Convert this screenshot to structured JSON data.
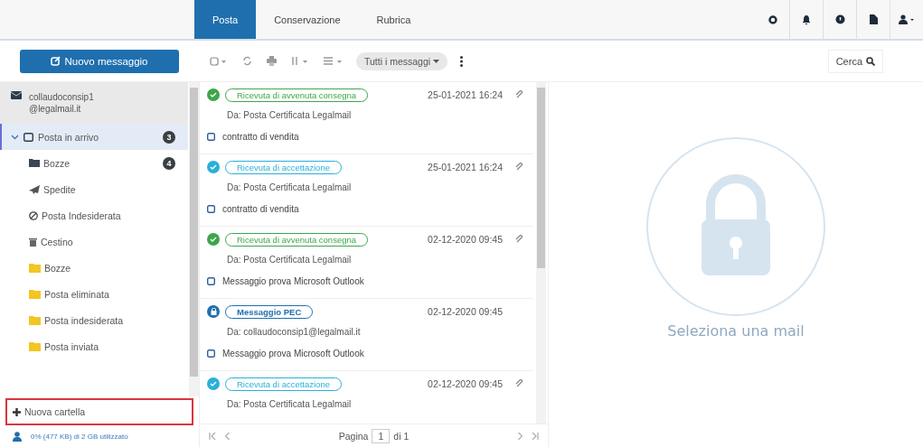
{
  "tabs": [
    {
      "label": "Posta",
      "selected": true
    },
    {
      "label": "Conservazione",
      "selected": false
    },
    {
      "label": "Rubrica",
      "selected": false
    }
  ],
  "header_icons": [
    {
      "kind": "gear"
    },
    {
      "kind": "bell"
    },
    {
      "kind": "help"
    },
    {
      "kind": "file"
    },
    {
      "kind": "user"
    }
  ],
  "new_message_button": "Nuovo messaggio",
  "toolbar": {
    "filter": "Tutti i messaggi",
    "search_button": "Cerca"
  },
  "account": {
    "name": "collaudoconsip1\n@legalmail.it"
  },
  "folders": [
    {
      "label": "Posta in arrivo",
      "kind": "inbox",
      "selected": true,
      "badge": "3",
      "expanded": true,
      "children": [
        {
          "label": "Bozze",
          "kind": "drafts",
          "selected": false,
          "badge": "4"
        },
        {
          "label": "Spedite",
          "kind": "sent",
          "selected": false
        },
        {
          "label": "Posta Indesiderata",
          "kind": "spam",
          "selected": false
        },
        {
          "label": "Cestino",
          "kind": "trash",
          "selected": false
        },
        {
          "label": "Bozze",
          "kind": "folder",
          "selected": false
        },
        {
          "label": "Posta eliminata",
          "kind": "folder",
          "selected": false
        },
        {
          "label": "Posta indesiderata",
          "kind": "folder",
          "selected": false
        },
        {
          "label": "Posta inviata",
          "kind": "folder",
          "selected": false
        }
      ]
    }
  ],
  "new_folder_button": "Nuova cartella",
  "storage": "0% (477 KB) di 2 GB utilizzato",
  "messages": [
    {
      "kind": "delivered",
      "tag": "Ricevuta di avvenuta consegna",
      "color": "#3ea64a",
      "date": "25-01-2021 16:24",
      "attachment": true,
      "from": "Da: Posta Certificata Legalmail",
      "subject": "contratto di vendita"
    },
    {
      "kind": "accepted",
      "tag": "Ricevuta di accettazione",
      "color": "#2ab0d8",
      "date": "25-01-2021 16:24",
      "attachment": true,
      "from": "Da: Posta Certificata Legalmail",
      "subject": "contratto di vendita"
    },
    {
      "kind": "delivered",
      "tag": "Ricevuta di avvenuta consegna",
      "color": "#3ea64a",
      "date": "02-12-2020 09:45",
      "attachment": true,
      "from": "Da: Posta Certificata Legalmail",
      "subject": "Messaggio prova Microsoft Outlook"
    },
    {
      "kind": "pec",
      "tag": "Messaggio PEC",
      "color": "#1f6fae",
      "date": "02-12-2020 09:45",
      "attachment": false,
      "from": "Da: collaudoconsip1@legalmail.it",
      "subject": "Messaggio prova Microsoft Outlook"
    },
    {
      "kind": "accepted",
      "tag": "Ricevuta di accettazione",
      "color": "#2ab0d8",
      "date": "02-12-2020 09:45",
      "attachment": true,
      "from": "Da: Posta Certificata Legalmail"
    }
  ],
  "pager": {
    "label": "Pagina",
    "page": "1",
    "total": "di 1"
  },
  "preview": {
    "empty_text": "Seleziona una mail"
  }
}
